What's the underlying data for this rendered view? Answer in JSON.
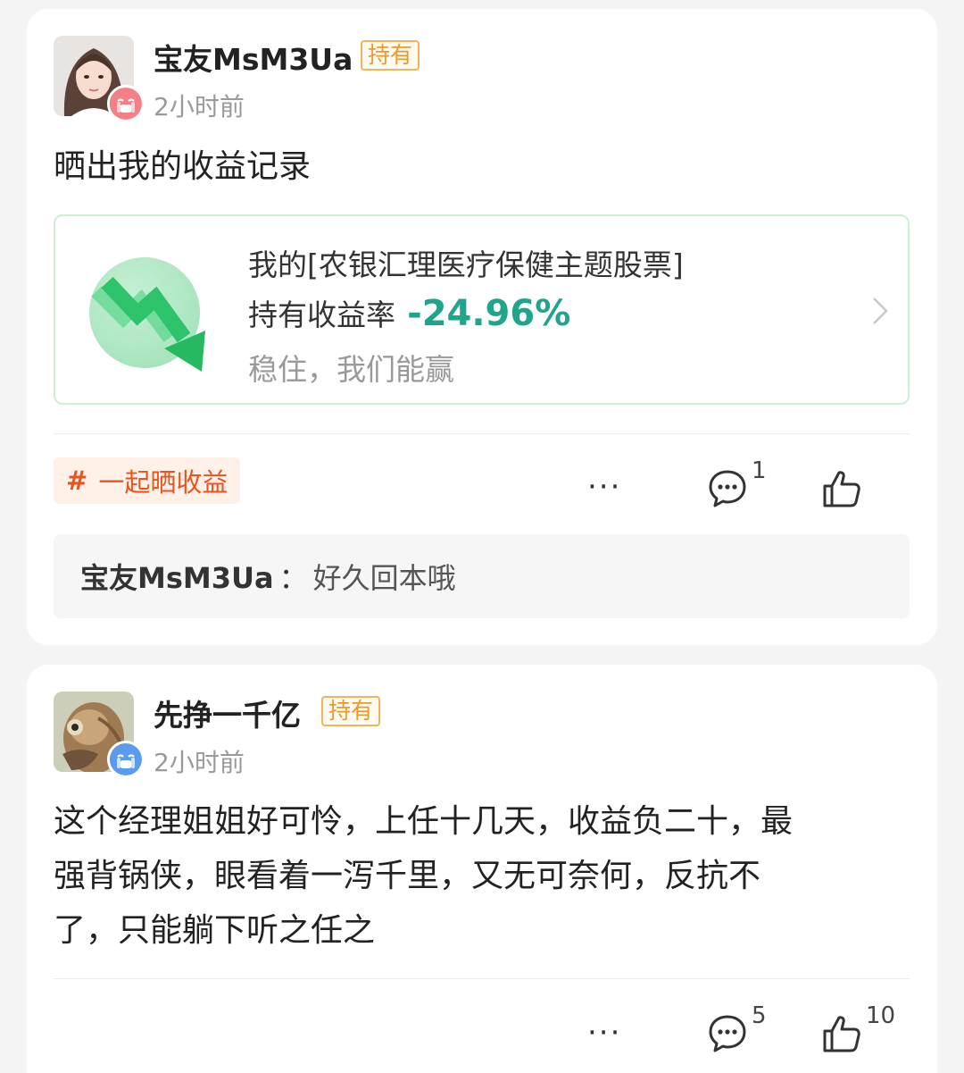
{
  "posts": [
    {
      "username": "宝友MsM3Ua",
      "tag": "持有",
      "time": "2小时前",
      "text": "晒出我的收益记录",
      "profit_card": {
        "fund_name": "我的[农银汇理医疗保健主题股票]",
        "rate_label": "持有收益率",
        "rate_value": "-24.96%",
        "slogan": "稳住，我们能赢"
      },
      "topic": "一起晒收益",
      "topic_symbol": "#",
      "more": "···",
      "comment_count": "1",
      "like_count": "",
      "top_comment": {
        "user": "宝友MsM3Ua",
        "colon": "：",
        "text": "好久回本哦"
      }
    },
    {
      "username": "先挣一千亿",
      "tag": "持有",
      "time": "2小时前",
      "text_lines": [
        "这个经理姐姐好可怜，上任十几天，收益负二十，最",
        "强背锅侠，眼看着一泻千里，又无可奈何，反抗不",
        "了，只能躺下听之任之"
      ],
      "more": "···",
      "comment_count": "5",
      "like_count": "10"
    }
  ],
  "colors": {
    "accent_green": "#1ea58c",
    "tag_orange": "#e99a2c",
    "topic_red": "#e9541e"
  },
  "icons": [
    "avatar-photo",
    "crying-emoji-badge",
    "down-trend-icon",
    "chevron-right-icon",
    "more-icon",
    "comment-icon",
    "like-icon"
  ]
}
